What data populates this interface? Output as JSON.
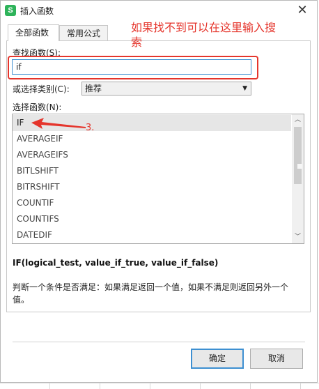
{
  "window": {
    "title": "插入函数",
    "app_icon_letter": "S",
    "close_glyph": "✕"
  },
  "tabs": [
    {
      "label": "全部函数",
      "active": true
    },
    {
      "label": "常用公式",
      "active": false
    }
  ],
  "annotation": {
    "hint": "如果找不到可以在这里输入搜索",
    "step": "3.",
    "color": "#e5352c"
  },
  "search": {
    "label": "查找函数(S):",
    "value": "if"
  },
  "category": {
    "label": "或选择类别(C):",
    "selected": "推荐"
  },
  "function_list": {
    "label": "选择函数(N):",
    "items": [
      "IF",
      "AVERAGEIF",
      "AVERAGEIFS",
      "BITLSHIFT",
      "BITRSHIFT",
      "COUNTIF",
      "COUNTIFS",
      "DATEDIF"
    ],
    "selected": "IF"
  },
  "details": {
    "signature": "IF(logical_test, value_if_true, value_if_false)",
    "description": "判断一个条件是否满足：如果满足返回一个值，如果不满足则返回另外一个值。"
  },
  "buttons": {
    "ok": "确定",
    "cancel": "取消"
  },
  "colors": {
    "accent_blue": "#3d8fd1",
    "app_icon_green": "#2eb35a"
  }
}
